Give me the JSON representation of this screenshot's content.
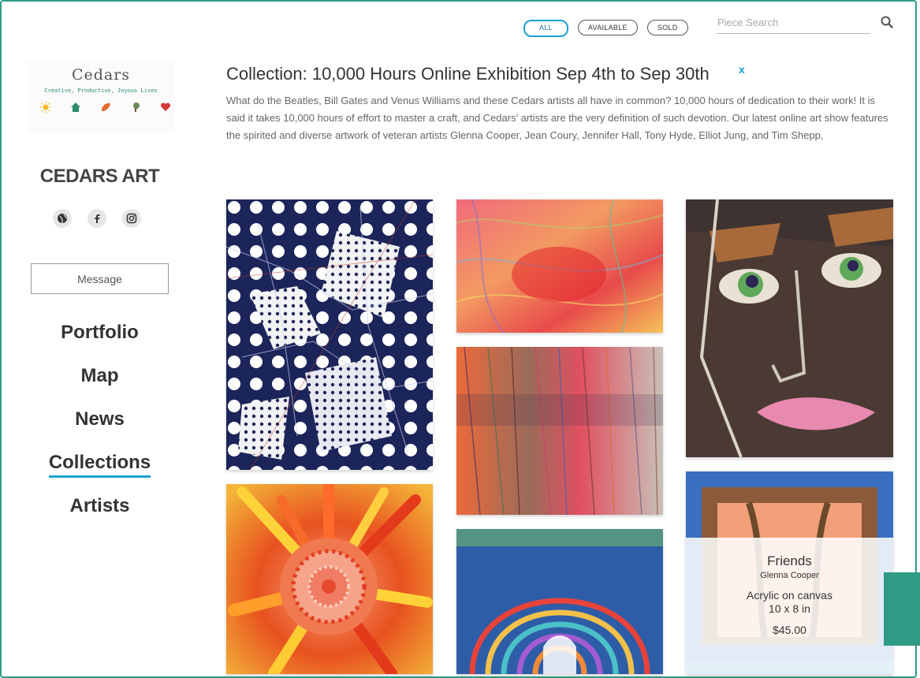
{
  "filters": {
    "all": "ALL",
    "available": "AVAILABLE",
    "sold": "SOLD"
  },
  "search": {
    "placeholder": "Piece Search",
    "icon": "search-icon"
  },
  "logo": {
    "title": "Cedars",
    "tagline": "Creative, Productive, Joyous Lives"
  },
  "sidebar": {
    "brand": "CEDARS ART",
    "socials": [
      "globe-icon",
      "facebook-icon",
      "instagram-icon"
    ],
    "message_label": "Message",
    "nav": [
      {
        "label": "Portfolio"
      },
      {
        "label": "Map"
      },
      {
        "label": "News"
      },
      {
        "label": "Collections",
        "active": true
      },
      {
        "label": "Artists"
      }
    ]
  },
  "collection": {
    "title": "Collection: 10,000 Hours Online Exhibition Sep 4th to Sep 30th",
    "close": "x",
    "description": "What do the Beatles, Bill Gates and Venus Williams and these Cedars artists all have in common? 10,000 hours of dedication to their work! It is said it takes 10,000 hours of effort to master a craft, and Cedars’ artists are the very definition of such devotion. Our latest online art show features the spirited and diverse artwork of veteran artists Glenna Cooper, Jean Coury, Jennifer Hall, Tony Hyde, Elliot Jung, and Tim Shepp,"
  },
  "featured_piece": {
    "title": "Friends",
    "artist": "Glenna Cooper",
    "medium": "Acrylic on canvas",
    "size": "10 x 8 in",
    "price": "$45.00"
  },
  "colors": {
    "accent": "#1ba3d4",
    "brand_green": "#2e9b86"
  }
}
